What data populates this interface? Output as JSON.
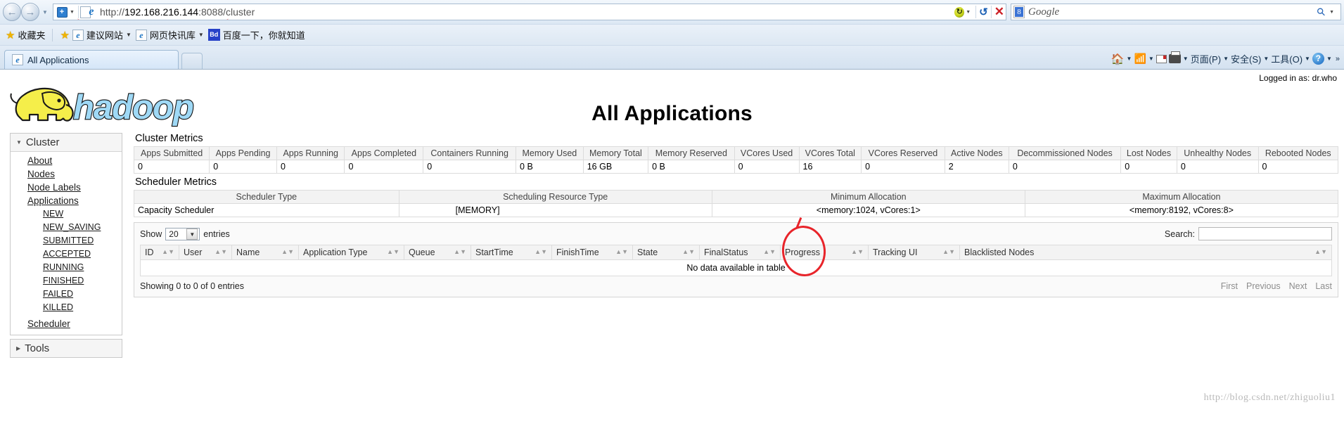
{
  "browser": {
    "back_label": "←",
    "forward_label": "→",
    "url": "http://192.168.216.144:8088/cluster",
    "url_host": "192.168.216.144",
    "url_scheme": "http://",
    "url_rest": ":8088/cluster",
    "search_placeholder": "Google",
    "shield_label": "✦",
    "refresh_label": "↺",
    "stop_label": "✕",
    "google_letter": "8",
    "search_icon": "⚲",
    "favorites": {
      "title": "收藏夹",
      "items": [
        {
          "label": "建议网站",
          "has_caret": true
        },
        {
          "label": "网页快讯库",
          "has_caret": true
        },
        {
          "label": "百度一下，你就知道",
          "has_caret": false
        }
      ]
    },
    "tab": {
      "title": "All Applications"
    },
    "command_bar": [
      {
        "label": "",
        "icon": "home-icon",
        "caret": true
      },
      {
        "label": "",
        "icon": "rss-icon",
        "caret": true
      },
      {
        "label": "",
        "icon": "read-mail-icon",
        "caret": false
      },
      {
        "label": "",
        "icon": "print-icon",
        "caret": true
      },
      {
        "label": "页面(P)",
        "icon": "",
        "caret": true
      },
      {
        "label": "安全(S)",
        "icon": "",
        "caret": true
      },
      {
        "label": "工具(O)",
        "icon": "",
        "caret": true
      },
      {
        "label": "",
        "icon": "help-icon",
        "caret": true
      }
    ],
    "overflow": "»"
  },
  "page": {
    "title": "All Applications",
    "logged_in": "Logged in as: dr.who",
    "logo_text": "hadoop",
    "watermark": "http://blog.csdn.net/zhiguoliu1"
  },
  "sidebar": {
    "cluster_header": "Cluster",
    "tools_header": "Tools",
    "links": [
      {
        "label": "About",
        "sub": false
      },
      {
        "label": "Nodes",
        "sub": false
      },
      {
        "label": "Node Labels",
        "sub": false
      },
      {
        "label": "Applications",
        "sub": false
      },
      {
        "label": "NEW",
        "sub": true
      },
      {
        "label": "NEW_SAVING",
        "sub": true
      },
      {
        "label": "SUBMITTED",
        "sub": true
      },
      {
        "label": "ACCEPTED",
        "sub": true
      },
      {
        "label": "RUNNING",
        "sub": true
      },
      {
        "label": "FINISHED",
        "sub": true
      },
      {
        "label": "FAILED",
        "sub": true
      },
      {
        "label": "KILLED",
        "sub": true
      }
    ],
    "scheduler_link": "Scheduler"
  },
  "cluster_metrics": {
    "title": "Cluster Metrics",
    "headers": [
      "Apps Submitted",
      "Apps Pending",
      "Apps Running",
      "Apps Completed",
      "Containers Running",
      "Memory Used",
      "Memory Total",
      "Memory Reserved",
      "VCores Used",
      "VCores Total",
      "VCores Reserved",
      "Active Nodes",
      "Decommissioned Nodes",
      "Lost Nodes",
      "Unhealthy Nodes",
      "Rebooted Nodes"
    ],
    "values": [
      "0",
      "0",
      "0",
      "0",
      "0",
      "0 B",
      "16 GB",
      "0 B",
      "0",
      "16",
      "0",
      "2",
      "0",
      "0",
      "0",
      "0"
    ],
    "highlighted_metric": "Active Nodes",
    "highlight_color": "#e8242a"
  },
  "scheduler_metrics": {
    "title": "Scheduler Metrics",
    "headers": [
      "Scheduler Type",
      "Scheduling Resource Type",
      "Minimum Allocation",
      "Maximum Allocation"
    ],
    "row": [
      "Capacity Scheduler",
      "[MEMORY]",
      "<memory:1024, vCores:1>",
      "<memory:8192, vCores:8>"
    ]
  },
  "datatable": {
    "show_label": "Show",
    "entries_label": "entries",
    "page_size": "20",
    "search_label": "Search:",
    "search_value": "",
    "headers": [
      "ID",
      "User",
      "Name",
      "Application Type",
      "Queue",
      "StartTime",
      "FinishTime",
      "State",
      "FinalStatus",
      "Progress",
      "Tracking UI",
      "Blacklisted Nodes"
    ],
    "empty_message": "No data available in table",
    "info": "Showing 0 to 0 of 0 entries",
    "pager": {
      "first": "First",
      "previous": "Previous",
      "next": "Next",
      "last": "Last"
    }
  }
}
